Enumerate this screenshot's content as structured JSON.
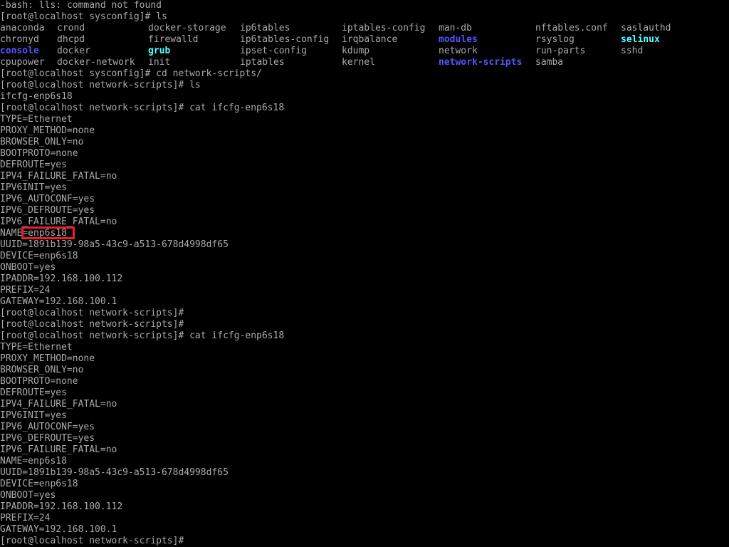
{
  "colors": {
    "background": "#000000",
    "foreground": "#aaaaaa",
    "directory": "#5555ff",
    "symlink": "#55ffff",
    "highlight_border": "#e8202a"
  },
  "lines_top": [
    "-bash: lls: command not found",
    "[root@localhost sysconfig]# ls"
  ],
  "ls_rows": [
    [
      {
        "text": "anaconda",
        "type": "file"
      },
      {
        "text": "crond",
        "type": "file"
      },
      {
        "text": "docker-storage",
        "type": "file"
      },
      {
        "text": "ip6tables",
        "type": "file"
      },
      {
        "text": "iptables-config",
        "type": "file"
      },
      {
        "text": "man-db",
        "type": "file"
      },
      {
        "text": "nftables.conf",
        "type": "file"
      },
      {
        "text": "saslauthd",
        "type": "file"
      }
    ],
    [
      {
        "text": "chronyd",
        "type": "file"
      },
      {
        "text": "dhcpd",
        "type": "file"
      },
      {
        "text": "firewalld",
        "type": "file"
      },
      {
        "text": "ip6tables-config",
        "type": "file"
      },
      {
        "text": "irqbalance",
        "type": "file"
      },
      {
        "text": "modules",
        "type": "dir"
      },
      {
        "text": "rsyslog",
        "type": "file"
      },
      {
        "text": "selinux",
        "type": "link"
      }
    ],
    [
      {
        "text": "console",
        "type": "dir"
      },
      {
        "text": "docker",
        "type": "file"
      },
      {
        "text": "grub",
        "type": "link"
      },
      {
        "text": "ipset-config",
        "type": "file"
      },
      {
        "text": "kdump",
        "type": "file"
      },
      {
        "text": "network",
        "type": "file"
      },
      {
        "text": "run-parts",
        "type": "file"
      },
      {
        "text": "sshd",
        "type": "file"
      }
    ],
    [
      {
        "text": "cpupower",
        "type": "file"
      },
      {
        "text": "docker-network",
        "type": "file"
      },
      {
        "text": "init",
        "type": "file"
      },
      {
        "text": "iptables",
        "type": "file"
      },
      {
        "text": "kernel",
        "type": "file"
      },
      {
        "text": "network-scripts",
        "type": "dir"
      },
      {
        "text": "samba",
        "type": "file"
      },
      {
        "text": "",
        "type": "file"
      }
    ]
  ],
  "lines_rest": [
    "[root@localhost sysconfig]# cd network-scripts/",
    "[root@localhost network-scripts]# ls",
    "ifcfg-enp6s18",
    "[root@localhost network-scripts]# cat ifcfg-enp6s18",
    "TYPE=Ethernet",
    "PROXY_METHOD=none",
    "BROWSER_ONLY=no",
    "BOOTPROTO=none",
    "DEFROUTE=yes",
    "IPV4_FAILURE_FATAL=no",
    "IPV6INIT=yes",
    "IPV6_AUTOCONF=yes",
    "IPV6_DEFROUTE=yes",
    "IPV6_FAILURE_FATAL=no",
    "NAME=enp6s18",
    "UUID=1891b139-98a5-43c9-a513-678d4998df65",
    "DEVICE=enp6s18",
    "ONBOOT=yes",
    "IPADDR=192.168.100.112",
    "PREFIX=24",
    "GATEWAY=192.168.100.1",
    "[root@localhost network-scripts]#",
    "[root@localhost network-scripts]#",
    "[root@localhost network-scripts]# cat ifcfg-enp6s18",
    "TYPE=Ethernet",
    "PROXY_METHOD=none",
    "BROWSER_ONLY=no",
    "BOOTPROTO=none",
    "DEFROUTE=yes",
    "IPV4_FAILURE_FATAL=no",
    "IPV6INIT=yes",
    "IPV6_AUTOCONF=yes",
    "IPV6_DEFROUTE=yes",
    "IPV6_FAILURE_FATAL=no",
    "NAME=enp6s18",
    "UUID=1891b139-98a5-43c9-a513-678d4998df65",
    "DEVICE=enp6s18",
    "ONBOOT=yes",
    "IPADDR=192.168.100.112",
    "PREFIX=24",
    "GATEWAY=192.168.100.1",
    "[root@localhost network-scripts]#"
  ]
}
